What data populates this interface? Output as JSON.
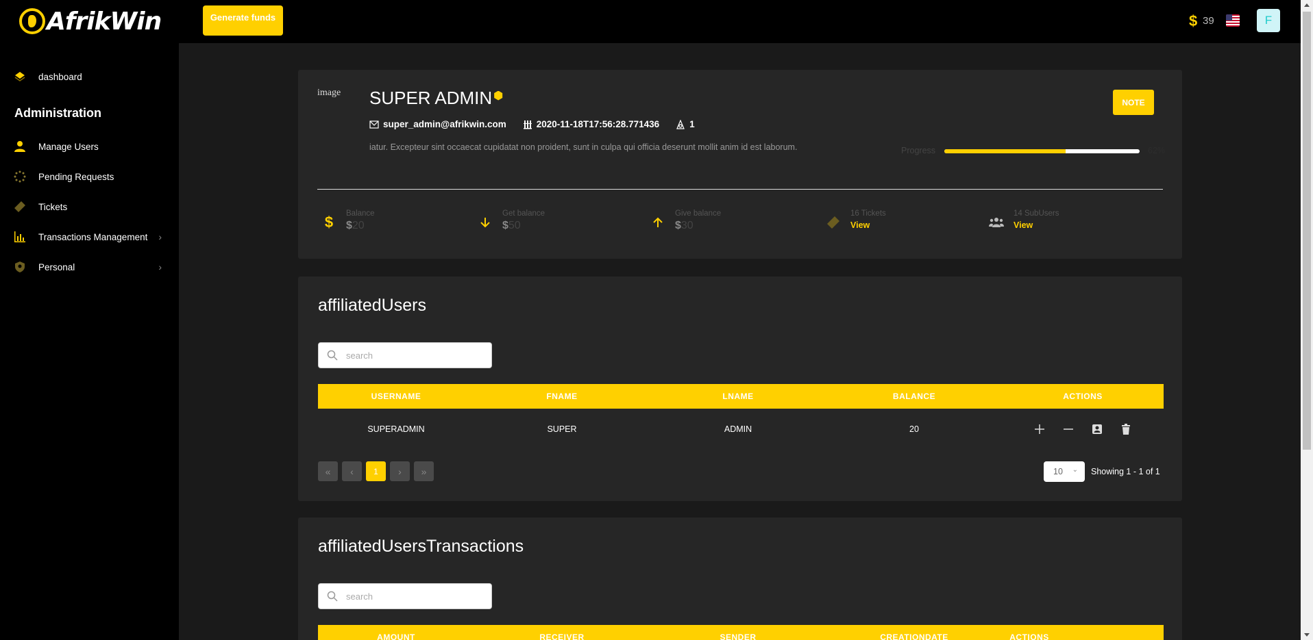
{
  "topbar": {
    "brand": "AfrikWin",
    "generate_funds": "Generate funds",
    "coin_symbol": "$",
    "coin_count": "39",
    "avatar_letter": "F"
  },
  "sidebar": {
    "dashboard": "dashboard",
    "heading": "Administration",
    "items": [
      {
        "label": "Manage Users",
        "icon": "user-icon"
      },
      {
        "label": "Pending Requests",
        "icon": "spinner-icon"
      },
      {
        "label": "Tickets",
        "icon": "ticket-icon"
      },
      {
        "label": "Transactions Management",
        "icon": "chart-icon"
      },
      {
        "label": "Personal",
        "icon": "shield-icon"
      }
    ]
  },
  "profile": {
    "image_alt": "image",
    "name": "SUPER ADMIN",
    "email": "super_admin@afrikwin.com",
    "created": "2020-11-18T17:56:28.771436",
    "level": "1",
    "bio": "iatur. Excepteur sint occaecat cupidatat non proident, sunt in culpa qui officia deserunt mollit anim id est laborum.",
    "note_button": "NOTE",
    "progress_label": "Progress",
    "progress_percent": 62,
    "progress_value_text": "62%",
    "stats": {
      "balance_label": "Balance",
      "balance_symbol": "$",
      "balance_value": "20",
      "get_label": "Get balance",
      "get_symbol": "$",
      "get_value": "50",
      "give_label": "Give balance",
      "give_symbol": "$",
      "give_value": "30",
      "tickets_label": "16 Tickets",
      "tickets_link": "View",
      "subusers_label": "14 SubUsers",
      "subusers_link": "View"
    }
  },
  "affiliated_users": {
    "title": "affiliatedUsers",
    "search_placeholder": "search",
    "columns": [
      "USERNAME",
      "FNAME",
      "LNAME",
      "BALANCE",
      "ACTIONS"
    ],
    "rows": [
      {
        "username": "SUPERADMIN",
        "fname": "SUPER",
        "lname": "ADMIN",
        "balance": "20"
      }
    ],
    "pager": {
      "first": "«",
      "prev": "‹",
      "current": "1",
      "next": "›",
      "last": "»"
    },
    "per_page": "10",
    "showing": "Showing 1 - 1 of 1"
  },
  "affiliated_transactions": {
    "title": "affiliatedUsersTransactions",
    "search_placeholder": "search",
    "columns": [
      "AMOUNT",
      "RECEIVER",
      "SENDER",
      "CREATIONDATE",
      "ACTIONS"
    ]
  },
  "colors": {
    "accent": "#ffd000",
    "sidebar": "#000000",
    "card": "#262626",
    "background": "#1a1a1a"
  }
}
